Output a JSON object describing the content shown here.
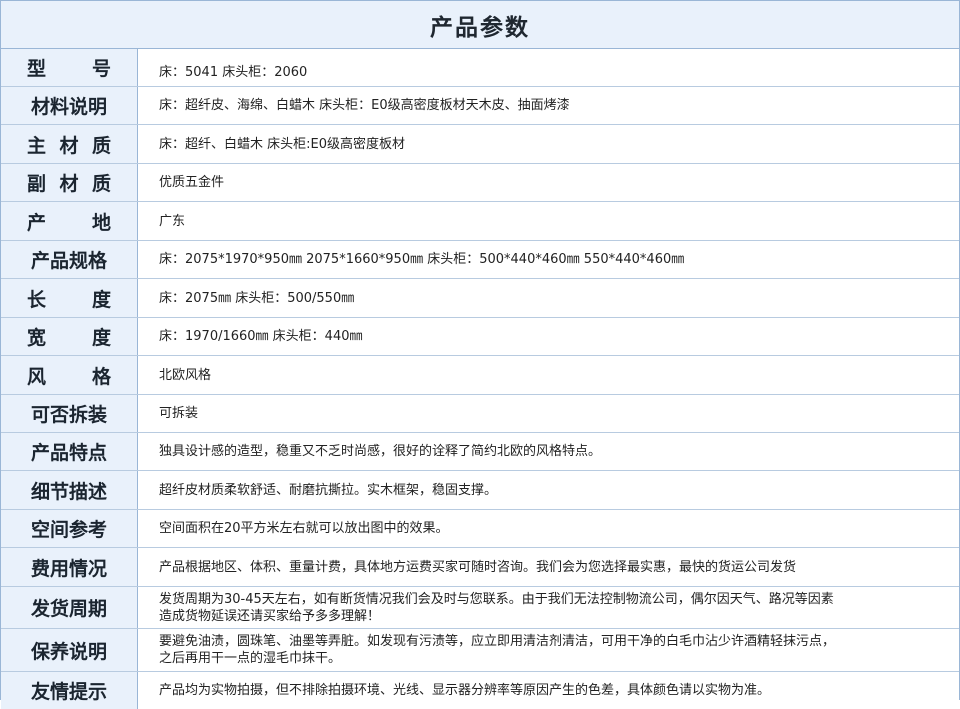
{
  "title": "产品参数",
  "rows": [
    {
      "label": "型号",
      "value": "床：5041  床头柜：2060"
    },
    {
      "label": "材料说明",
      "value": "床：超纤皮、海绵、白蜡木    床头柜：E0级高密度板材天木皮、抽面烤漆"
    },
    {
      "label": "主材质",
      "value": "床：超纤、白蜡木  床头柜:E0级高密度板材"
    },
    {
      "label": "副材质",
      "value": "优质五金件"
    },
    {
      "label": "产地",
      "value": "广东"
    },
    {
      "label": "产品规格",
      "value": "床：2075*1970*950㎜   2075*1660*950㎜  床头柜：500*440*460㎜   550*440*460㎜"
    },
    {
      "label": "长度",
      "value": "床：2075㎜  床头柜：500/550㎜"
    },
    {
      "label": "宽度",
      "value": "床：1970/1660㎜  床头柜：440㎜"
    },
    {
      "label": "风格",
      "value": "北欧风格"
    },
    {
      "label": "可否拆装",
      "value": "可拆装"
    },
    {
      "label": "产品特点",
      "value": "独具设计感的造型，稳重又不乏时尚感，很好的诠释了简约北欧的风格特点。"
    },
    {
      "label": "细节描述",
      "value": "超纤皮材质柔软舒适、耐磨抗撕拉。实木框架，稳固支撑。"
    },
    {
      "label": "空间参考",
      "value": "空间面积在20平方米左右就可以放出图中的效果。"
    },
    {
      "label": "费用情况",
      "value": "产品根据地区、体积、重量计费，具体地方运费买家可随时咨询。我们会为您选择最实惠，最快的货运公司发货"
    },
    {
      "label": "发货周期",
      "value": "发货周期为30-45天左右，如有断货情况我们会及时与您联系。由于我们无法控制物流公司，偶尔因天气、路况等因素",
      "value2": "造成货物延误还请买家给予多多理解！"
    },
    {
      "label": "保养说明",
      "value": "要避免油渍，圆珠笔、油墨等弄脏。如发现有污渍等，应立即用清洁剂清洁，可用干净的白毛巾沾少许酒精轻抹污点，",
      "value2": "之后再用干一点的湿毛巾抹干。"
    },
    {
      "label": "友情提示",
      "value": "产品均为实物拍摄，但不排除拍摄环境、光线、显示器分辨率等原因产生的色差，具体颜色请以实物为准。"
    }
  ]
}
